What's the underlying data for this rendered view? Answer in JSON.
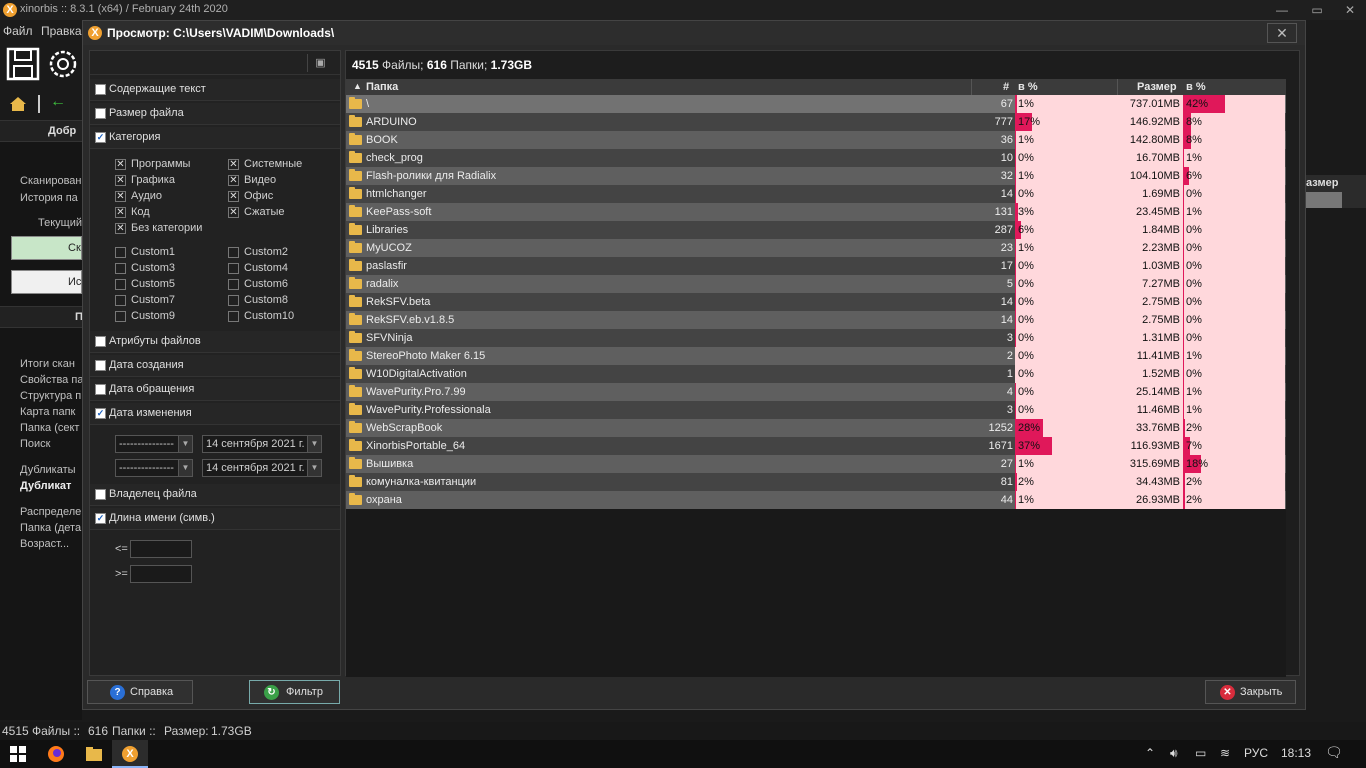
{
  "app": {
    "title": "xinorbis :: 8.3.1 (x64) / February 24th 2020",
    "menu": [
      "Файл",
      "Правка"
    ],
    "left_welcome": "Добр",
    "left_links_a": [
      "Сканирован",
      "История па"
    ],
    "current_label": "Текущий",
    "btn_scan": "Ск",
    "btn_hist": "Ис",
    "section_p": "П",
    "left_links_b": [
      "Итоги скан",
      "Свойства па",
      "Структура п",
      "Карта папк",
      "Папка (сект",
      "Поиск"
    ],
    "dup_a": "Дубликаты",
    "dup_b": "Дубликат",
    "left_links_c": [
      "Распределе",
      "Папка (дета",
      "Возраст..."
    ],
    "right_hdr": "азмер",
    "status": {
      "files": "4515",
      "files_lbl": "Файлы ::",
      "folders": "616",
      "folders_lbl": "Папки ::",
      "size_lbl": "Размер:",
      "size": "1.73GB"
    }
  },
  "dialog": {
    "title": "Просмотр: C:\\Users\\VADIM\\Downloads\\",
    "close": "✕",
    "summary": {
      "files": "4515",
      "files_lbl": "Файлы;",
      "folders": "616",
      "folders_lbl": "Папки;",
      "size": "1.73GB"
    },
    "filters": {
      "contains_text": "Содержащие текст",
      "file_size": "Размер файла",
      "category": "Категория",
      "categories": [
        "Программы",
        "Системные",
        "Графика",
        "Видео",
        "Аудио",
        "Офис",
        "Код",
        "Сжатые",
        "Без категории"
      ],
      "custom": [
        "Custom1",
        "Custom2",
        "Custom3",
        "Custom4",
        "Custom5",
        "Custom6",
        "Custom7",
        "Custom8",
        "Custom9",
        "Custom10"
      ],
      "attributes": "Атрибуты файлов",
      "created": "Дата создания",
      "accessed": "Дата обращения",
      "modified": "Дата изменения",
      "date_op1": "---------------",
      "date_op2": "---------------",
      "date1": "14 сентября 2021 г.",
      "date2": "14 сентября 2021 г.",
      "owner": "Владелец файла",
      "name_len": "Длина имени (симв.)",
      "lte": "<=",
      "gte": ">="
    },
    "columns": {
      "folder": "Папка",
      "count": "#",
      "pct": "в %",
      "size": "Размер",
      "size_pct": "в %"
    },
    "rows": [
      {
        "name": "\\",
        "count": "67",
        "pct": "1%",
        "pct_val": 1.5,
        "size": "737.01MB",
        "spct": "42%",
        "spct_val": 41.6
      },
      {
        "name": "ARDUINO",
        "count": "777",
        "pct": "17%",
        "pct_val": 17.2,
        "size": "146.92MB",
        "spct": "8%",
        "spct_val": 8.3
      },
      {
        "name": "BOOK",
        "count": "36",
        "pct": "1%",
        "pct_val": 0.8,
        "size": "142.80MB",
        "spct": "8%",
        "spct_val": 8.0
      },
      {
        "name": "check_prog",
        "count": "10",
        "pct": "0%",
        "pct_val": 0.2,
        "size": "16.70MB",
        "spct": "1%",
        "spct_val": 0.9
      },
      {
        "name": "Flash-ролики для Radialix",
        "count": "32",
        "pct": "1%",
        "pct_val": 0.7,
        "size": "104.10MB",
        "spct": "6%",
        "spct_val": 5.9
      },
      {
        "name": "htmlchanger",
        "count": "14",
        "pct": "0%",
        "pct_val": 0.3,
        "size": "1.69MB",
        "spct": "0%",
        "spct_val": 0.1
      },
      {
        "name": "KeePass-soft",
        "count": "131",
        "pct": "3%",
        "pct_val": 2.9,
        "size": "23.45MB",
        "spct": "1%",
        "spct_val": 1.3
      },
      {
        "name": "Libraries",
        "count": "287",
        "pct": "6%",
        "pct_val": 6.4,
        "size": "1.84MB",
        "spct": "0%",
        "spct_val": 0.1
      },
      {
        "name": "MyUCOZ",
        "count": "23",
        "pct": "1%",
        "pct_val": 0.5,
        "size": "2.23MB",
        "spct": "0%",
        "spct_val": 0.1
      },
      {
        "name": "paslasfir",
        "count": "17",
        "pct": "0%",
        "pct_val": 0.4,
        "size": "1.03MB",
        "spct": "0%",
        "spct_val": 0.1
      },
      {
        "name": "radalix",
        "count": "5",
        "pct": "0%",
        "pct_val": 0.1,
        "size": "7.27MB",
        "spct": "0%",
        "spct_val": 0.4
      },
      {
        "name": "RekSFV.beta",
        "count": "14",
        "pct": "0%",
        "pct_val": 0.3,
        "size": "2.75MB",
        "spct": "0%",
        "spct_val": 0.2
      },
      {
        "name": "RekSFV.eb.v1.8.5",
        "count": "14",
        "pct": "0%",
        "pct_val": 0.3,
        "size": "2.75MB",
        "spct": "0%",
        "spct_val": 0.2
      },
      {
        "name": "SFVNinja",
        "count": "3",
        "pct": "0%",
        "pct_val": 0.1,
        "size": "1.31MB",
        "spct": "0%",
        "spct_val": 0.1
      },
      {
        "name": "StereoPhoto Maker 6.15",
        "count": "2",
        "pct": "0%",
        "pct_val": 0.0,
        "size": "11.41MB",
        "spct": "1%",
        "spct_val": 0.6
      },
      {
        "name": "W10DigitalActivation",
        "count": "1",
        "pct": "0%",
        "pct_val": 0.0,
        "size": "1.52MB",
        "spct": "0%",
        "spct_val": 0.1
      },
      {
        "name": "WavePurity.Pro.7.99",
        "count": "4",
        "pct": "0%",
        "pct_val": 0.1,
        "size": "25.14MB",
        "spct": "1%",
        "spct_val": 1.4
      },
      {
        "name": "WavePurity.Professionala",
        "count": "3",
        "pct": "0%",
        "pct_val": 0.1,
        "size": "11.46MB",
        "spct": "1%",
        "spct_val": 0.6
      },
      {
        "name": "WebScrapBook",
        "count": "1252",
        "pct": "28%",
        "pct_val": 27.7,
        "size": "33.76MB",
        "spct": "2%",
        "spct_val": 1.9
      },
      {
        "name": "XinorbisPortable_64",
        "count": "1671",
        "pct": "37%",
        "pct_val": 37.0,
        "size": "116.93MB",
        "spct": "7%",
        "spct_val": 6.6
      },
      {
        "name": "Вышивка",
        "count": "27",
        "pct": "1%",
        "pct_val": 0.6,
        "size": "315.69MB",
        "spct": "18%",
        "spct_val": 17.8
      },
      {
        "name": "комуналка-квитанции",
        "count": "81",
        "pct": "2%",
        "pct_val": 1.8,
        "size": "34.43MB",
        "spct": "2%",
        "spct_val": 1.9
      },
      {
        "name": "охрана",
        "count": "44",
        "pct": "1%",
        "pct_val": 1.0,
        "size": "26.93MB",
        "spct": "2%",
        "spct_val": 1.5
      }
    ],
    "buttons": {
      "help": "Справка",
      "filter": "Фильтр",
      "close": "Закрыть"
    }
  },
  "taskbar": {
    "lang": "РУС",
    "time": "18:13"
  },
  "colors": {
    "bar_fill": "#e0185a",
    "bar_bg": "#ffd8dc",
    "logo": "#f0a030"
  }
}
